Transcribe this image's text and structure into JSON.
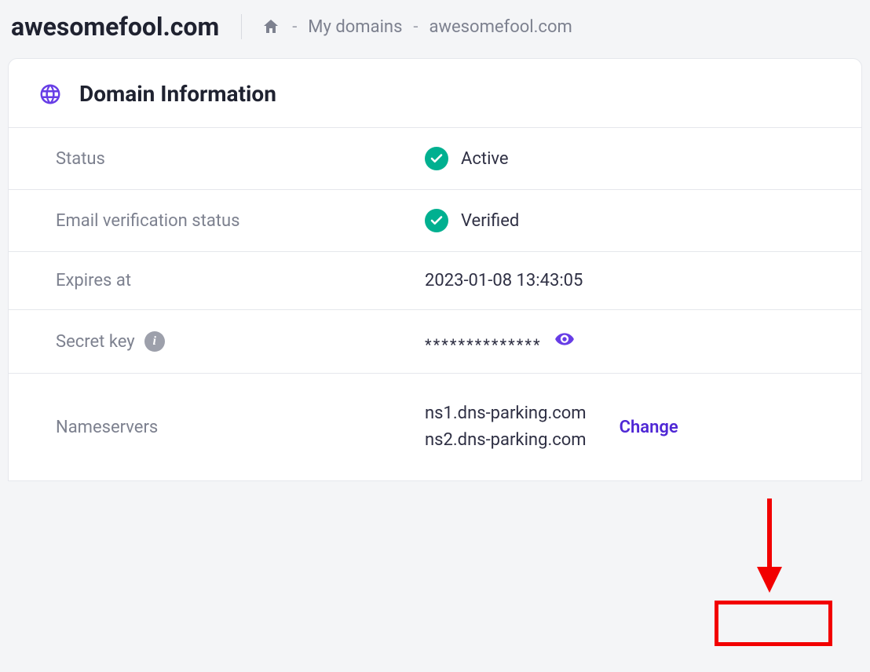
{
  "header": {
    "domain": "awesomefool.com",
    "breadcrumb": {
      "my_domains": "My domains",
      "current": "awesomefool.com"
    }
  },
  "panel": {
    "title": "Domain Information"
  },
  "rows": {
    "status": {
      "label": "Status",
      "value": "Active"
    },
    "email_verification": {
      "label": "Email verification status",
      "value": "Verified"
    },
    "expires": {
      "label": "Expires at",
      "value": "2023-01-08 13:43:05"
    },
    "secret_key": {
      "label": "Secret key",
      "masked": "**************"
    },
    "nameservers": {
      "label": "Nameservers",
      "ns1": "ns1.dns-parking.com",
      "ns2": "ns2.dns-parking.com",
      "change": "Change"
    }
  }
}
